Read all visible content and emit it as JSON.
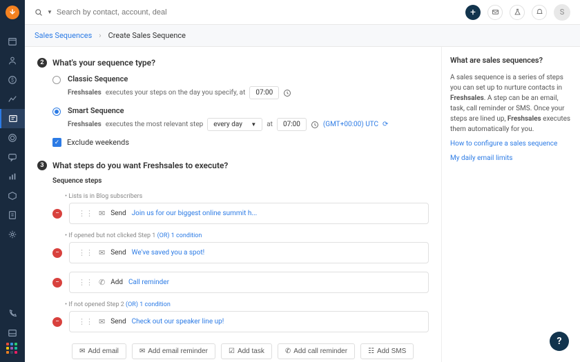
{
  "search": {
    "placeholder": "Search by contact, account, deal"
  },
  "avatar_initial": "S",
  "breadcrumb": {
    "root": "Sales Sequences",
    "current": "Create Sales Sequence"
  },
  "q2": {
    "title": "What's your sequence type?",
    "classic": {
      "label": "Classic Sequence",
      "desc_prefix": "Freshsales",
      "desc": "executes your steps on the day you specify, at",
      "time": "07:00"
    },
    "smart": {
      "label": "Smart Sequence",
      "desc_prefix": "Freshsales",
      "desc": "executes the most relevant step",
      "frequency": "every day",
      "at": "at",
      "time": "07:00",
      "tz": "(GMT+00:00) UTC",
      "tz_icon": "⟳"
    },
    "exclude": "Exclude weekends"
  },
  "q3": {
    "title": "What steps do you want Freshsales to execute?",
    "steps_label": "Sequence steps",
    "cond1": "Lists is in Blog subscribers",
    "step1": {
      "verb": "Send",
      "link": "Join us for our biggest online summit h..."
    },
    "cond2_prefix": "If opened but not clicked Step 1",
    "cond2_or": "(OR) 1 condition",
    "step2": {
      "verb": "Send",
      "link": "We've saved you a spot!"
    },
    "step3": {
      "verb": "Add",
      "link": "Call reminder"
    },
    "cond3_prefix": "If not opened Step 2",
    "cond3_or": "(OR) 1 condition",
    "step4": {
      "verb": "Send",
      "link": "Check out our speaker line up!"
    },
    "buttons": {
      "email": "Add email",
      "email_reminder": "Add email reminder",
      "task": "Add task",
      "call": "Add call reminder",
      "sms": "Add SMS"
    }
  },
  "aside": {
    "title": "What are sales sequences?",
    "body1": "A sales sequence is a series of steps you can set up to nurture contacts in ",
    "brand": "Freshsales",
    "body2": ". A step can be an email, task, call reminder or SMS. Once your steps are lined up, ",
    "body3": " executes them automatically for you.",
    "link1": "How to configure a sales sequence",
    "link2": "My daily email limits"
  }
}
